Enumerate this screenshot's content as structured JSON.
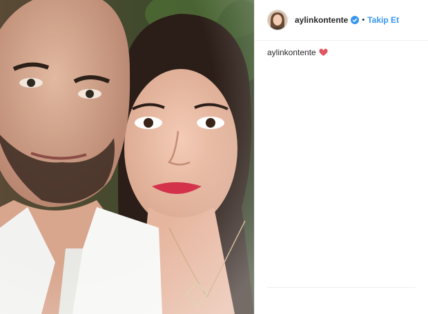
{
  "post": {
    "author": {
      "username": "aylinkontente",
      "verified_icon": "verified-badge-icon",
      "separator": "•",
      "follow_label": "Takip Et"
    },
    "caption": {
      "username": "aylinkontente",
      "emoji_icon": "heart-icon"
    },
    "photo": {
      "icon": "selfie-photo"
    }
  },
  "colors": {
    "follow": "#3897f0",
    "verified": "#3897f0",
    "heart": "#e0555f",
    "text": "#262626",
    "divider": "#efefef"
  }
}
